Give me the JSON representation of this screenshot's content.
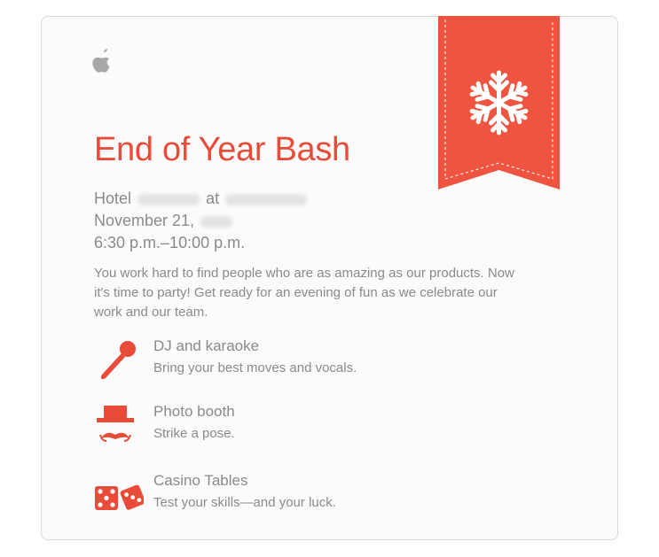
{
  "event": {
    "title": "End of Year Bash",
    "venue_prefix": "Hotel",
    "venue_connector": "at",
    "date_prefix": "November 21,",
    "time": "6:30 p.m.–10:00 p.m."
  },
  "intro": "You work hard to find people who are as amazing as our products. Now it's time to party! Get ready for an evening of fun as we celebrate our work and our team.",
  "features": [
    {
      "icon": "microphone-icon",
      "title": "DJ and karaoke",
      "description": "Bring your best moves and vocals."
    },
    {
      "icon": "hat-mustache-icon",
      "title": "Photo booth",
      "description": "Strike a pose."
    },
    {
      "icon": "dice-icon",
      "title": "Casino Tables",
      "description": "Test your skills—and your luck."
    }
  ],
  "brand": {
    "logo_icon": "apple-logo-icon",
    "ribbon_icon": "snowflake-icon"
  },
  "colors": {
    "accent": "#e84b38",
    "text": "#8a8a8a",
    "logo": "#a8a8a8"
  }
}
